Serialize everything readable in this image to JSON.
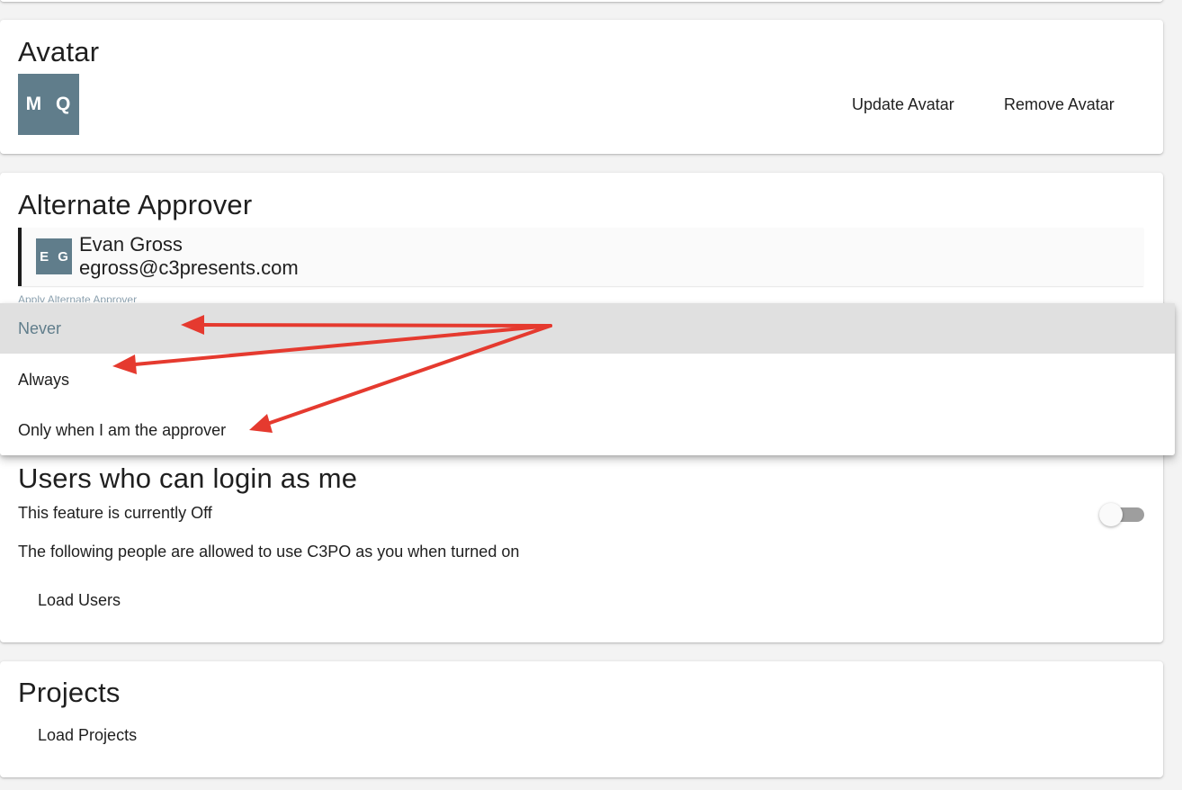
{
  "avatar_section": {
    "title": "Avatar",
    "initials": "M Q",
    "update_label": "Update Avatar",
    "remove_label": "Remove Avatar"
  },
  "approver_section": {
    "title": "Alternate Approver",
    "approver": {
      "initials": "E G",
      "name": "Evan Gross",
      "email": "egross@c3presents.com"
    },
    "apply_label": "Apply Alternate Approver",
    "dropdown_options": [
      {
        "label": "Never",
        "selected": true
      },
      {
        "label": "Always",
        "selected": false
      },
      {
        "label": "Only when I am the approver",
        "selected": false
      }
    ]
  },
  "login_section": {
    "title": "Users who can login as me",
    "status_text": "This feature is currently Off",
    "toggle_on": false,
    "description": "The following people are allowed to use C3PO as you when turned on",
    "load_users_label": "Load Users"
  },
  "projects_section": {
    "title": "Projects",
    "load_projects_label": "Load Projects"
  },
  "colors": {
    "avatar_bg": "#607d8b",
    "annotation_arrow": "#e53a2f",
    "selected_option_bg": "#e0e0e0"
  }
}
